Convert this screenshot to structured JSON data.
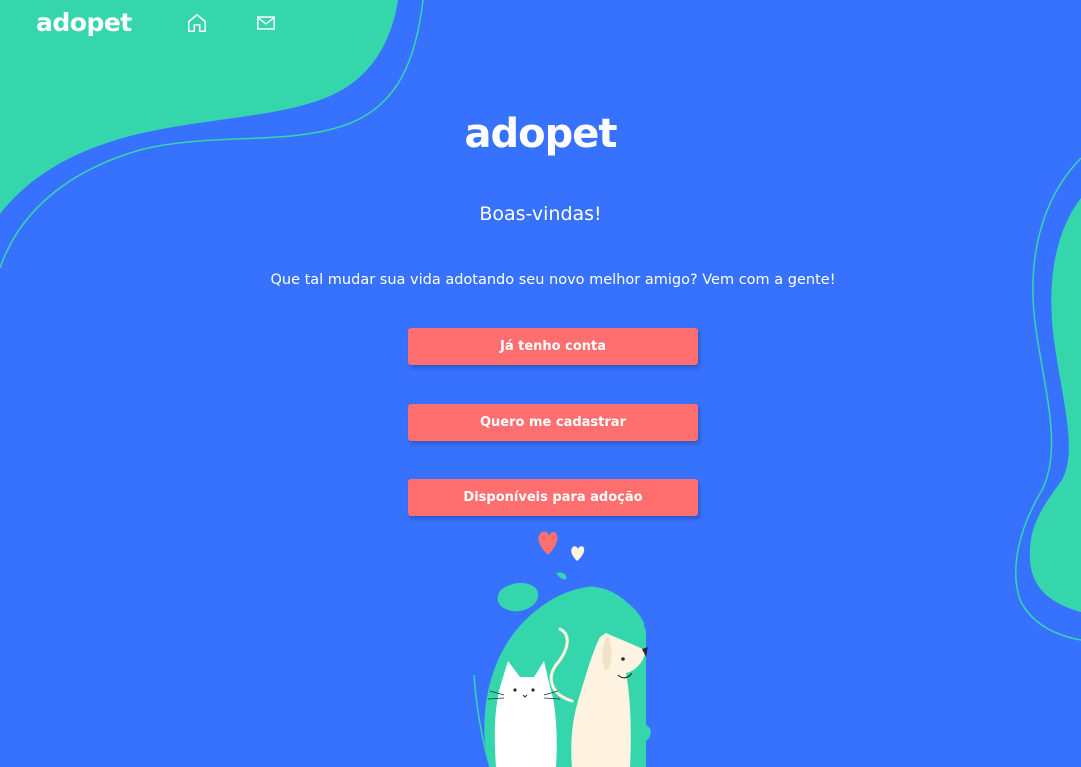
{
  "header": {
    "logo_text": "adopet",
    "nav": [
      {
        "icon": "home-icon"
      },
      {
        "icon": "mail-icon"
      }
    ]
  },
  "main": {
    "logo_text": "adopet",
    "welcome_title": "Boas-vindas!",
    "tagline": "Que tal mudar sua vida adotando seu novo melhor amigo? Vem com a gente!",
    "buttons": {
      "login_label": "Já tenho conta",
      "signup_label": "Quero me cadastrar",
      "available_label": "Disponíveis para adoção"
    }
  },
  "colors": {
    "background": "#3772FF",
    "accent_green": "#36D6AD",
    "button": "#FF6F6F",
    "text": "#FFFFFF",
    "cream": "#FFF4E2"
  }
}
